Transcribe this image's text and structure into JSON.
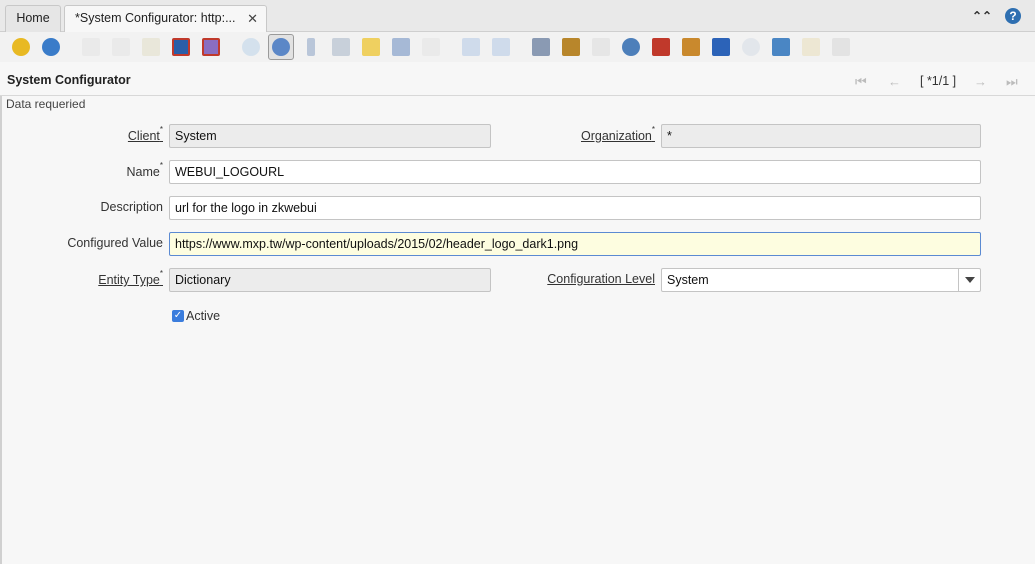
{
  "tabs": {
    "home_label": "Home",
    "active_label": "*System Configurator: http:...",
    "close_glyph": "✕"
  },
  "top_right": {
    "collapse_glyph": "⌃⌃",
    "help_glyph": "?"
  },
  "toolbar": {
    "icons": [
      "undo-icon",
      "help-icon",
      "new-record-icon",
      "copy-record-icon",
      "delete-icon",
      "save-icon",
      "save-and-new-icon",
      "refresh-icon",
      "find-icon",
      "attachment-icon",
      "chat-icon",
      "post-it-icon",
      "grid-toggle-icon",
      "parent-record-icon",
      "previous-record-icon",
      "next-record-icon",
      "report-icon",
      "archive-icon",
      "print-icon",
      "zoom-across-icon",
      "active-workflows-icon",
      "requests-icon",
      "product-info-icon",
      "process-icon",
      "export-icon",
      "import-icon",
      "customize-icon"
    ],
    "active_icon": "find-icon"
  },
  "window": {
    "title": "System Configurator",
    "record_indicator": "[ *1/1 ]",
    "nav": {
      "first": "⏮",
      "prev": "←",
      "next": "→",
      "last": "⏭"
    }
  },
  "status": {
    "message": "Data requeried"
  },
  "form": {
    "client": {
      "label": "Client",
      "required": "*",
      "value": "System"
    },
    "organization": {
      "label": "Organization",
      "required": "*",
      "value": "*"
    },
    "name": {
      "label": "Name",
      "required": "*",
      "value": "WEBUI_LOGOURL"
    },
    "description": {
      "label": "Description",
      "value": "url for the logo in zkwebui"
    },
    "configured_value": {
      "label": "Configured Value",
      "value": "https://www.mxp.tw/wp-content/uploads/2015/02/header_logo_dark1.png"
    },
    "entity_type": {
      "label": "Entity Type",
      "required": "*",
      "value": "Dictionary"
    },
    "configuration_level": {
      "label": "Configuration Level",
      "value": "System"
    },
    "active": {
      "label": "Active",
      "checked": true,
      "check_glyph": "✓"
    }
  },
  "colors": {
    "accent": "#3b7ddd",
    "focus_bg": "#fdfde0",
    "readonly_bg": "#ececec"
  }
}
